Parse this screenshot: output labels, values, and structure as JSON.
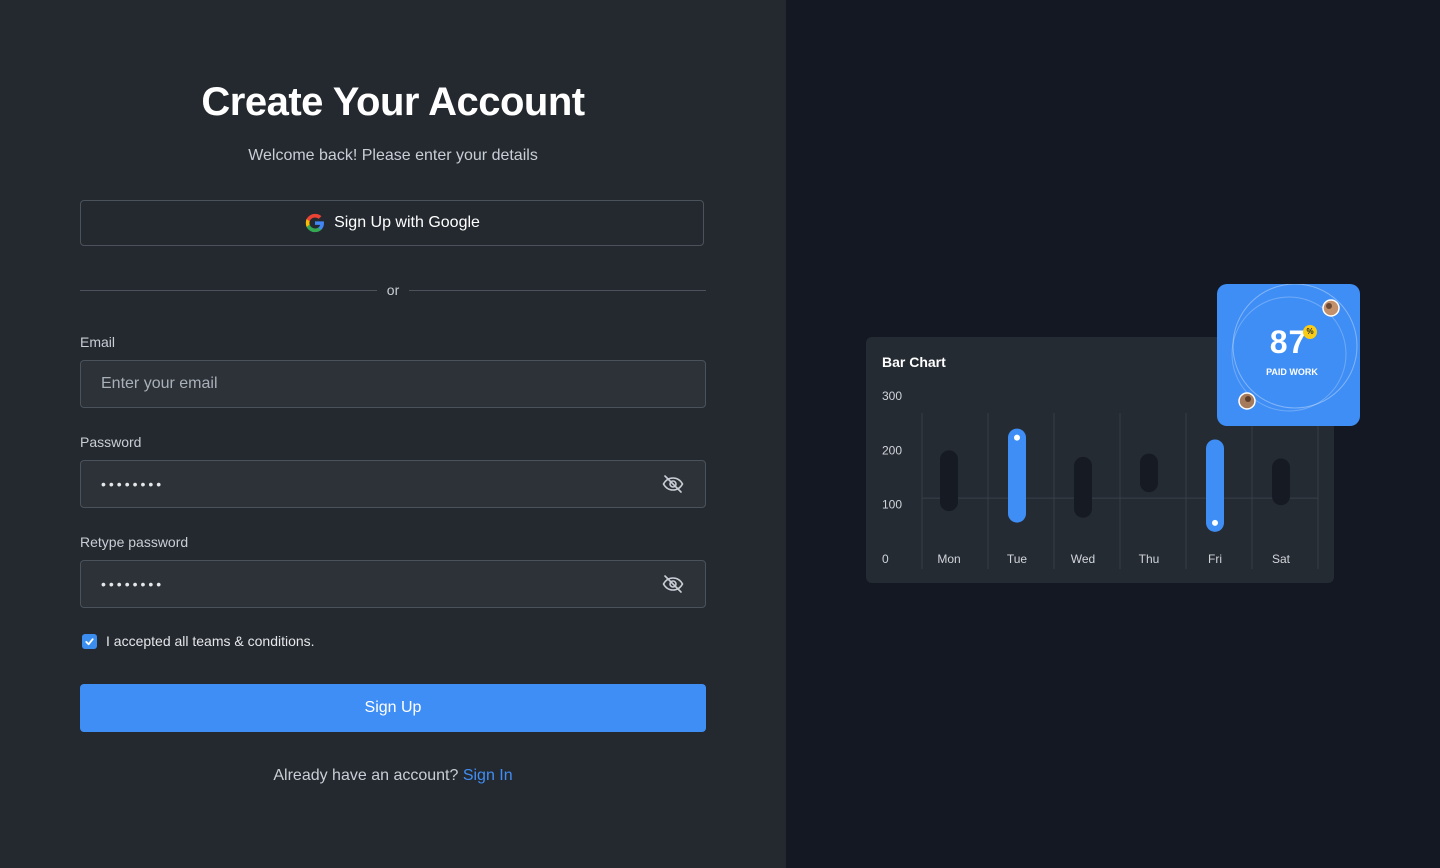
{
  "form": {
    "title": "Create Your Account",
    "subtitle": "Welcome back! Please enter your details",
    "google_button": "Sign Up with Google",
    "divider": "or",
    "email_label": "Email",
    "email_placeholder": "Enter your email",
    "password_label": "Password",
    "password_value": "••••••••",
    "retype_label": "Retype password",
    "retype_value": "••••••••",
    "terms_text": "I accepted all teams & conditions.",
    "terms_checked": true,
    "signup_button": "Sign Up",
    "signin_prompt": "Already have an account?",
    "signin_link": "Sign In"
  },
  "colors": {
    "accent": "#3f8ef5",
    "left_bg": "#24292f",
    "right_bg": "#131822",
    "card_bg": "#252b33",
    "bar_muted": "#151a23"
  },
  "stat_card": {
    "value": "87",
    "badge": "%",
    "label": "PAID WORK"
  },
  "chart_data": {
    "type": "bar",
    "title": "Bar Chart",
    "categories": [
      "Mon",
      "Tue",
      "Wed",
      "Thu",
      "Fri",
      "Sat"
    ],
    "y_ticks": [
      "300",
      "200",
      "100",
      "0"
    ],
    "ylim": [
      0,
      300
    ],
    "series": [
      {
        "ranges": [
          [
            88,
            200
          ],
          [
            67,
            240
          ],
          [
            76,
            188
          ],
          [
            123,
            194
          ],
          [
            50,
            220
          ],
          [
            99,
            185
          ]
        ],
        "highlighted": [
          false,
          true,
          false,
          false,
          true,
          false
        ]
      }
    ],
    "grid": true
  }
}
